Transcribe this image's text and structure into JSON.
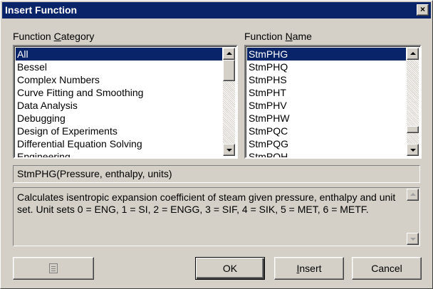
{
  "window": {
    "title": "Insert Function",
    "close_label": "×"
  },
  "category": {
    "label_prefix": "Function ",
    "label_accel": "C",
    "label_suffix": "ategory",
    "items": [
      "All",
      "Bessel",
      "Complex Numbers",
      "Curve Fitting and Smoothing",
      "Data Analysis",
      "Debugging",
      "Design of Experiments",
      "Differential Equation Solving",
      "Engineering"
    ],
    "selected": "All"
  },
  "function_name": {
    "label_prefix": "Function ",
    "label_accel": "N",
    "label_suffix": "ame",
    "items": [
      "StmPHG",
      "StmPHQ",
      "StmPHS",
      "StmPHT",
      "StmPHV",
      "StmPHW",
      "StmPQC",
      "StmPQG",
      "StmPQH"
    ],
    "selected": "StmPHG"
  },
  "syntax": "StmPHG(Pressure, enthalpy, units)",
  "description": "Calculates isentropic expansion coefficient of steam given pressure, enthalpy and unit set. Unit sets 0 = ENG, 1 = SI, 2 = ENGG, 3 = SIF, 4 = SIK, 5 = MET, 6 = METF.",
  "buttons": {
    "ok": "OK",
    "insert_accel": "I",
    "insert_rest": "nsert",
    "cancel": "Cancel"
  },
  "icons": {
    "help": "help-icon",
    "close": "close-icon"
  }
}
